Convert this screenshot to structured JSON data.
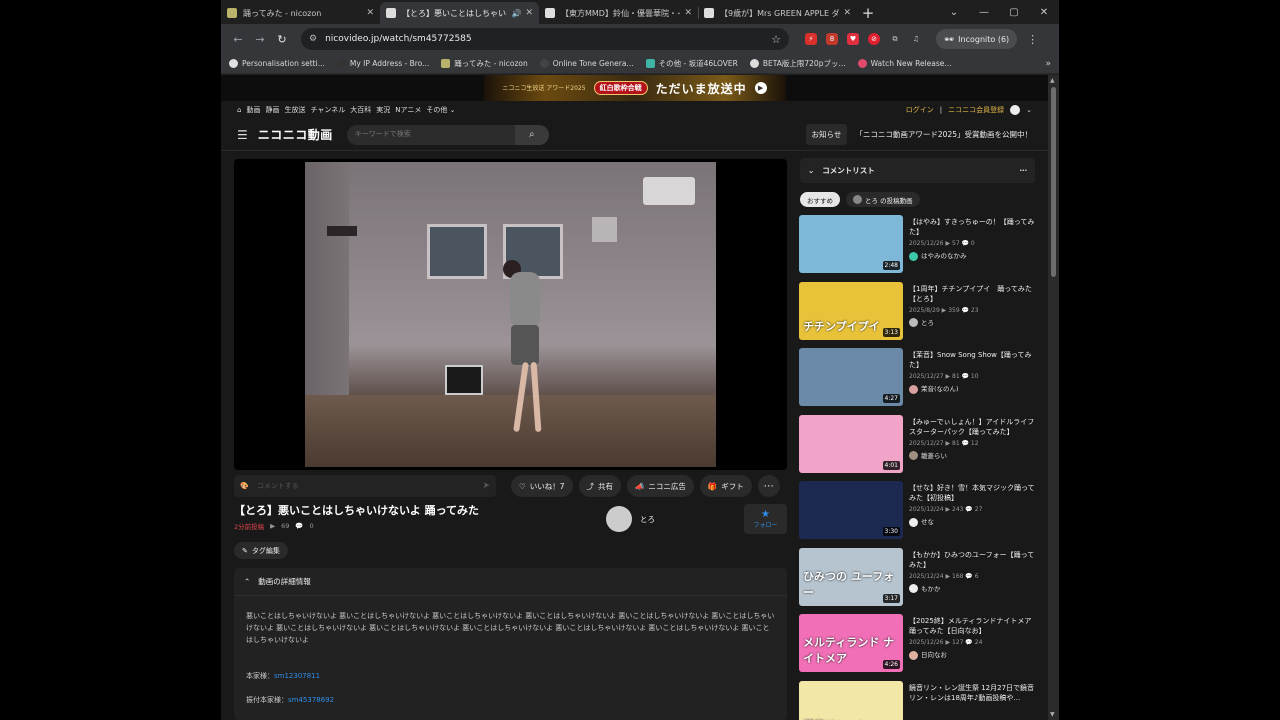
{
  "browser": {
    "tabs": [
      {
        "title": "踊ってみた - nicozon",
        "active": false,
        "fav_color": "#b8b26a"
      },
      {
        "title": "【とろ】悪いことはしちゃいけないよ",
        "active": true,
        "fav_color": "#dddddd"
      },
      {
        "title": "【東方MMD】鈴仙・優曇華院・イナ",
        "active": false,
        "fav_color": "#dddddd"
      },
      {
        "title": "【9歳が】Mrs GREEN APPLE ダンス",
        "active": false,
        "fav_color": "#dddddd"
      }
    ],
    "url": "nicovideo.jp/watch/sm45772585",
    "profile": "Incognito (6)",
    "bookmarks": [
      {
        "label": "Personalisation setti...",
        "color": "#e0e0e0"
      },
      {
        "label": "My IP Address - Bro...",
        "color": "#333333"
      },
      {
        "label": "踊ってみた - nicozon",
        "color": "#b8b26a"
      },
      {
        "label": "Online Tone Genera...",
        "color": "#444444"
      },
      {
        "label": "その他 - 坂道46LOVER",
        "color": "#3fb5a5"
      },
      {
        "label": "BETA版上限720pブッ...",
        "color": "#dddddd"
      },
      {
        "label": "Watch New Release...",
        "color": "#e04b6c"
      }
    ]
  },
  "banner": {
    "logo": "ニコニコ生放送 アワード2025",
    "badge": "紅白歌枠合戦",
    "live": "ただいま放送中"
  },
  "nico_nav": {
    "links": [
      "動画",
      "静画",
      "生放送",
      "チャンネル",
      "大百科",
      "実況",
      "Nアニメ",
      "その他 ⌄"
    ],
    "login": "ログイン",
    "register": "ニコニコ会員登録",
    "logo": "ニコニコ動画",
    "search_placeholder": "キーワードで検索",
    "notice_btn": "お知らせ",
    "notice_text": "「ニコニコ動画アワード2025」受賞動画を公開中！"
  },
  "video": {
    "comment_placeholder": "コメントする",
    "like": "いいね！7",
    "share": "共有",
    "ad": "ニコニ広告",
    "gift": "ギフト",
    "title": "【とろ】悪いことはしちゃいけないよ 踊ってみた",
    "date": "2分前投稿",
    "views": "69",
    "comments": "0",
    "uploader": "とろ",
    "follow": "フォロー",
    "tag_edit": "タグ編集"
  },
  "details": {
    "header": "動画の詳細情報",
    "description": "悪いことはしちゃいけないよ 悪いことはしちゃいけないよ 悪いことはしちゃいけないよ 悪いことはしちゃいけないよ 悪いことはしちゃいけないよ 悪いことはしちゃいけないよ 悪いことはしちゃいけないよ 悪いことはしちゃいけないよ 悪いことはしちゃいけないよ 悪いことはしちゃいけないよ 悪いことはしちゃいけないよ 悪いことはしちゃいけないよ",
    "orig_label": "本家様：",
    "orig_link": "sm12307811",
    "choreo_label": "振付本家様：",
    "choreo_link": "sm45378692"
  },
  "sidebar": {
    "header": "コメントリスト",
    "chip_recommend": "おすすめ",
    "chip_user": "とろ の投稿動画",
    "items": [
      {
        "title": "【はやみ】すきっちゅーの！【踊ってみた】",
        "meta": "2025/12/26 ▶ 57 💬 0",
        "user": "はやみのなかみ",
        "dur": "2:48",
        "thumb": "#7fb7d8",
        "ua": "#3bc9a8",
        "tx": ""
      },
      {
        "title": "【1周年】チチンプイプイ　踊ってみた【とろ】",
        "meta": "2025/8/29 ▶ 359 💬 23",
        "user": "とろ",
        "dur": "3:13",
        "thumb": "#e8c33a",
        "ua": "#bbbbbb",
        "tx": "チチンプイプイ"
      },
      {
        "title": "【茉音】Snow Song Show【踊ってみた】",
        "meta": "2025/12/27 ▶ 81 💬 10",
        "user": "茉音(なのん)",
        "dur": "4:27",
        "thumb": "#6b8aa8",
        "ua": "#d9a0a0",
        "tx": ""
      },
      {
        "title": "【みゅーでぃしょん！】アイドルライフスターターパック【踊ってみた】",
        "meta": "2025/12/27 ▶ 81 💬 12",
        "user": "雛菱らい",
        "dur": "4:01",
        "thumb": "#f2a3c8",
        "ua": "#a09080",
        "tx": ""
      },
      {
        "title": "【せな】好き！雪！本気マジック踊ってみた【初投稿】",
        "meta": "2025/12/24 ▶ 243 💬 27",
        "user": "せな",
        "dur": "3:30",
        "thumb": "#1c2a52",
        "ua": "#eeeeee",
        "tx": ""
      },
      {
        "title": "【もかか】ひみつのユーフォー【踊ってみた】",
        "meta": "2025/12/24 ▶ 168 💬 6",
        "user": "もかか",
        "dur": "3:17",
        "thumb": "#b6c4cf",
        "ua": "#eeeeee",
        "tx": "ひみつの ユーフォー"
      },
      {
        "title": "【2025終】メルティランドナイトメア 踊ってみた【日向なお】",
        "meta": "2025/12/26 ▶ 127 💬 24",
        "user": "日向なお",
        "dur": "4:26",
        "thumb": "#f06fb6",
        "ua": "#e0b0a0",
        "tx": "メルティランド ナイトメア"
      },
      {
        "title": "鏡音リン・レン誕生祭 12月27日で鏡音リン・レンは18周年♪動画投稿や…",
        "meta": "",
        "user": "",
        "dur": "",
        "thumb": "#f3e7a8",
        "ua": "#ffffff",
        "tx": "鏡音リン・レン"
      }
    ]
  }
}
